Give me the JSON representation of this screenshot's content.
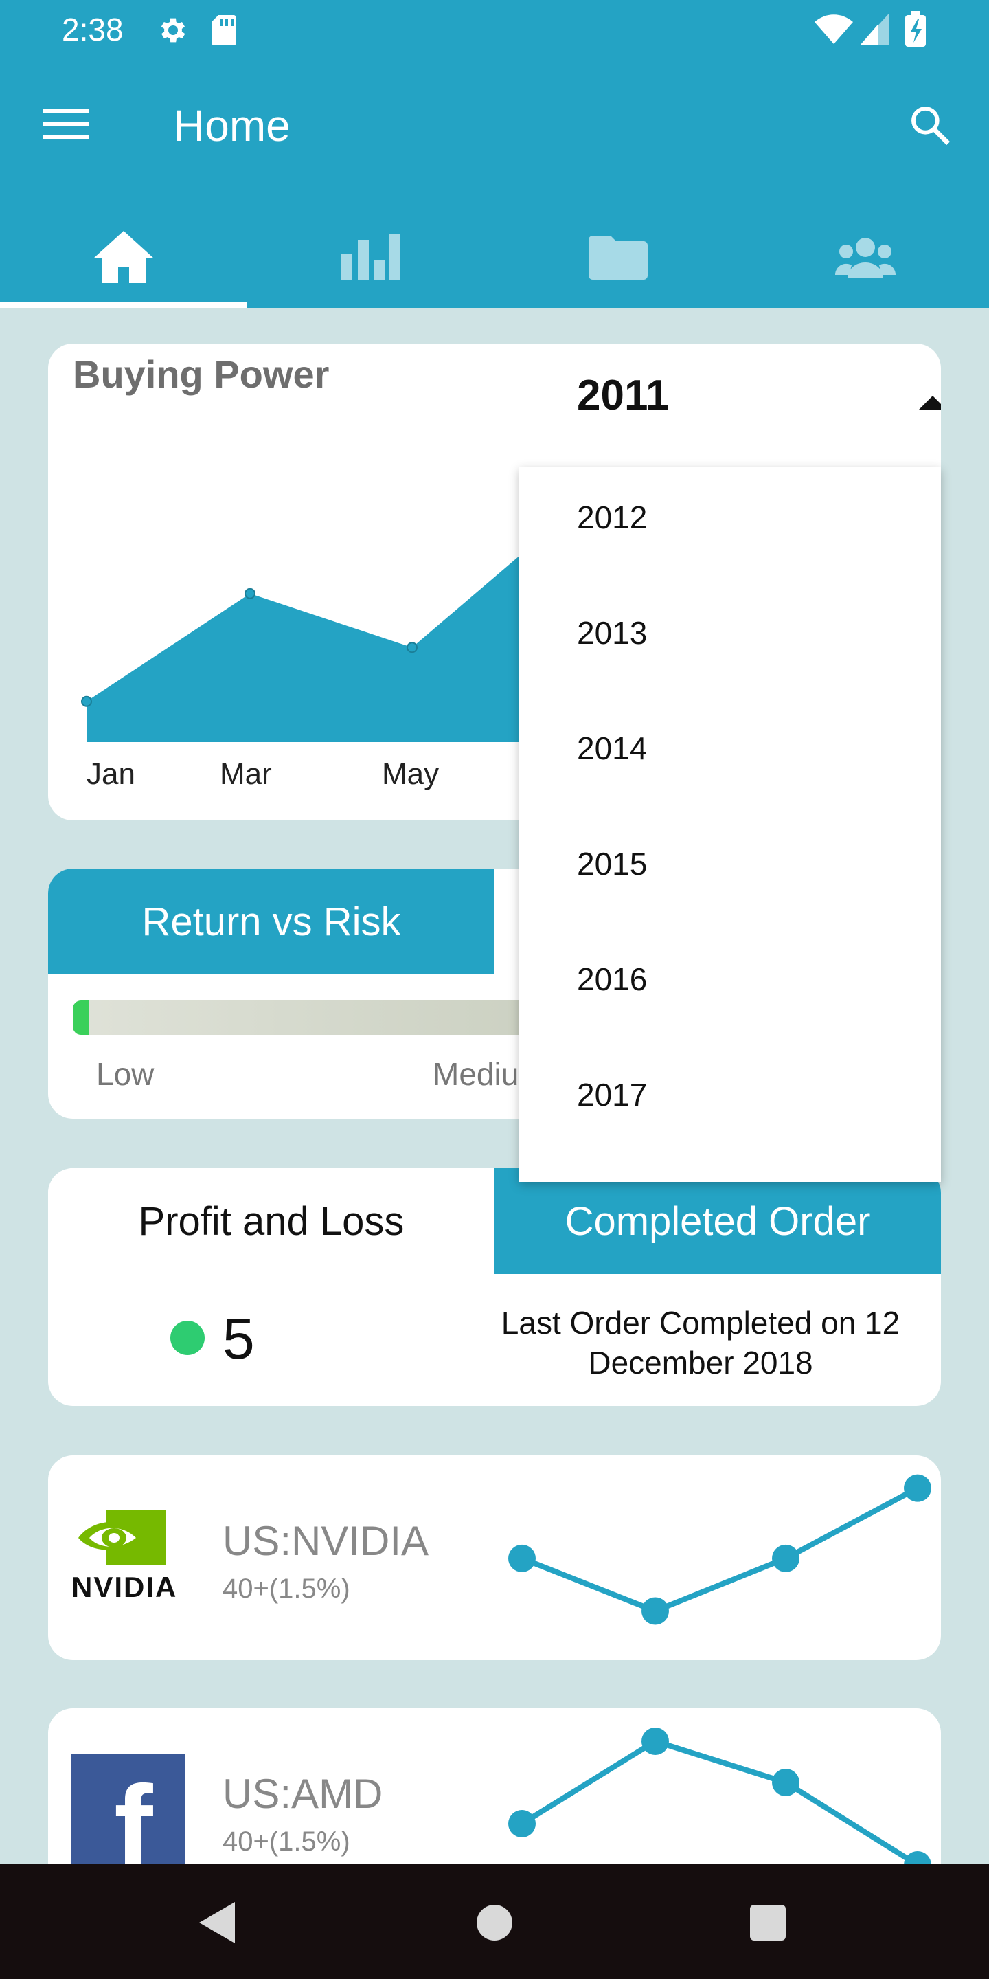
{
  "status_bar": {
    "time": "2:38"
  },
  "toolbar": {
    "title": "Home",
    "menu_icon": "menu-icon",
    "search_icon": "search-icon"
  },
  "tabs": [
    {
      "icon": "home-icon",
      "selected": true
    },
    {
      "icon": "bar-chart-icon",
      "selected": false
    },
    {
      "icon": "folder-icon",
      "selected": false
    },
    {
      "icon": "people-icon",
      "selected": false
    }
  ],
  "buying_power": {
    "title": "Buying Power",
    "selected_year": "2011",
    "year_options": [
      "2012",
      "2013",
      "2014",
      "2015",
      "2016",
      "2017"
    ]
  },
  "chart_data": {
    "type": "area",
    "title": "Buying Power",
    "categories": [
      "Jan",
      "Mar",
      "May"
    ],
    "values": [
      1,
      5,
      3
    ],
    "color": "#24a3c4"
  },
  "return_risk": {
    "tab_label": "Return vs Risk",
    "low_label": "Low",
    "medium_label": "Mediu"
  },
  "pnl": {
    "profit_tab": "Profit and Loss",
    "completed_tab": "Completed Order",
    "count": "5",
    "last_order": "Last Order Completed on 12 December 2018"
  },
  "stocks": [
    {
      "ticker": "US:NVIDIA",
      "change": "40+(1.5%)",
      "logo_text": "NVIDIA",
      "spark": [
        4,
        1,
        4,
        8
      ]
    },
    {
      "ticker": "US:AMD",
      "change": "40+(1.5%)",
      "logo_text": "f",
      "spark": [
        3,
        7,
        5,
        1
      ]
    }
  ],
  "colors": {
    "primary": "#24a3c4",
    "background": "#cfe3e4",
    "accent_green": "#2ecc71",
    "nvidia_green": "#76b900",
    "facebook_blue": "#3b5998"
  }
}
